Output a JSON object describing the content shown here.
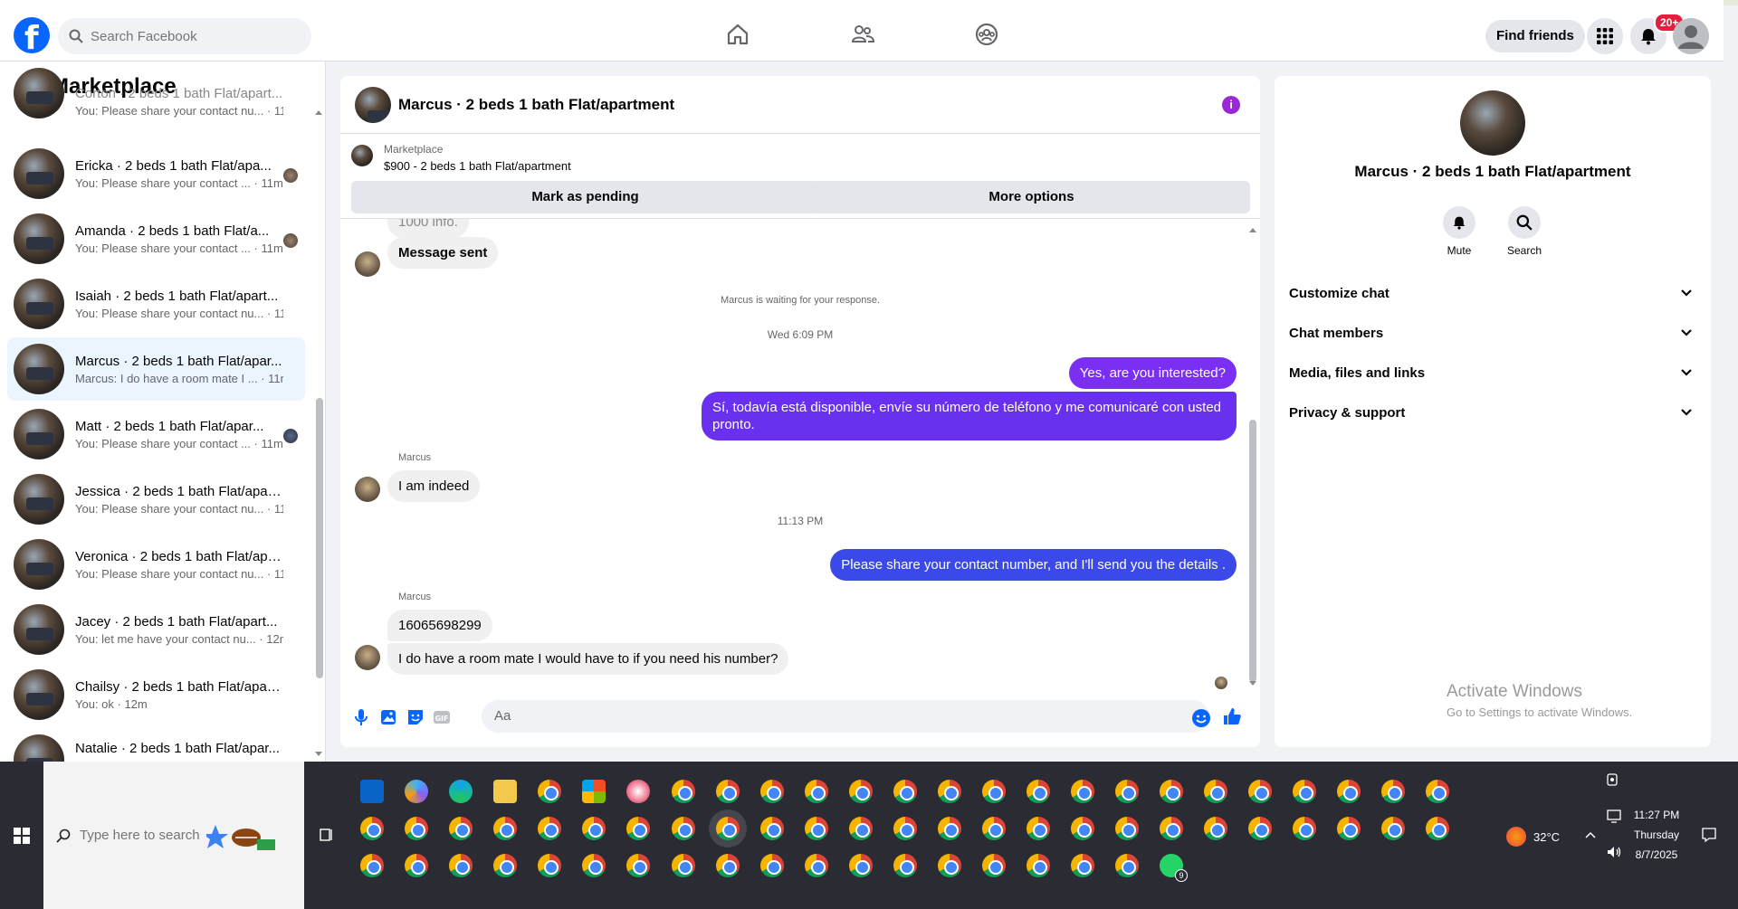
{
  "topbar": {
    "search_placeholder": "Search Facebook",
    "find_friends": "Find friends",
    "notification_count": "20+"
  },
  "left": {
    "title": "Marketplace",
    "threads": [
      {
        "name": "Corton · 2 beds 1 bath Flat/apart...",
        "preview": "You: Please share your contact nu... · 11m",
        "active": false
      },
      {
        "name": "Ericka · 2 beds 1 bath Flat/apa...",
        "preview": "You: Please share your contact ... · 11m",
        "active": false
      },
      {
        "name": "Amanda · 2 beds 1 bath Flat/a...",
        "preview": "You: Please share your contact ... · 11m",
        "active": false
      },
      {
        "name": "Isaiah · 2 beds 1 bath Flat/apart...",
        "preview": "You: Please share your contact nu... · 11m",
        "active": false
      },
      {
        "name": "Marcus · 2 beds 1 bath Flat/apar...",
        "preview": "Marcus: I do have a room mate I ... · 11m",
        "active": true
      },
      {
        "name": "Matt · 2 beds 1 bath Flat/apar...",
        "preview": "You: Please share your contact ... · 11m",
        "active": false
      },
      {
        "name": "Jessica · 2 beds 1 bath Flat/apart...",
        "preview": "You: Please share your contact nu... · 11m",
        "active": false
      },
      {
        "name": "Veronica · 2 beds 1 bath Flat/apa...",
        "preview": "You: Please share your contact nu... · 11m",
        "active": false
      },
      {
        "name": "Jacey · 2 beds 1 bath Flat/apart...",
        "preview": "You: let me have your contact nu... · 12m",
        "active": false
      },
      {
        "name": "Chailsy · 2 beds 1 bath Flat/apart...",
        "preview": "You: ok · 12m",
        "active": false
      },
      {
        "name": "Natalie · 2 beds 1 bath Flat/apar...",
        "preview": "",
        "active": false
      }
    ]
  },
  "chat": {
    "title": "Marcus · 2 beds 1 bath Flat/apartment",
    "marketplace_label": "Marketplace",
    "listing": "$900 - 2 beds 1 bath Flat/apartment",
    "mark_pending": "Mark as pending",
    "more_options": "More options",
    "partial_top": "1000 info.",
    "msg_sent": "Message sent",
    "waiting": "Marcus is waiting for your response.",
    "time1": "Wed 6:09 PM",
    "out1": "Yes, are you interested?",
    "out2": "Sí, todavía está disponible, envíe su número de teléfono y me comunicaré con usted pronto.",
    "sender": "Marcus",
    "in1": "I am indeed",
    "time2": "11:13 PM",
    "out3": "Please share your contact number, and I'll send you the details .",
    "in2": "16065698299",
    "in3": "I do have a room mate I would have to if you need his number?",
    "composer_placeholder": "Aa",
    "colors": {
      "purple": "#7b2ff2",
      "blue": "#3a49e8"
    }
  },
  "right": {
    "name": "Marcus · 2 beds 1 bath Flat/apartment",
    "mute": "Mute",
    "search": "Search",
    "rows": [
      "Customize chat",
      "Chat members",
      "Media, files and links",
      "Privacy & support"
    ]
  },
  "watermark": {
    "line1": "Activate Windows",
    "line2": "Go to Settings to activate Windows."
  },
  "taskbar": {
    "search_placeholder": "Type here to search",
    "temp": "32°C",
    "time": "11:27 PM",
    "day": "Thursday",
    "date": "8/7/2025",
    "whatsapp_count": "9"
  }
}
